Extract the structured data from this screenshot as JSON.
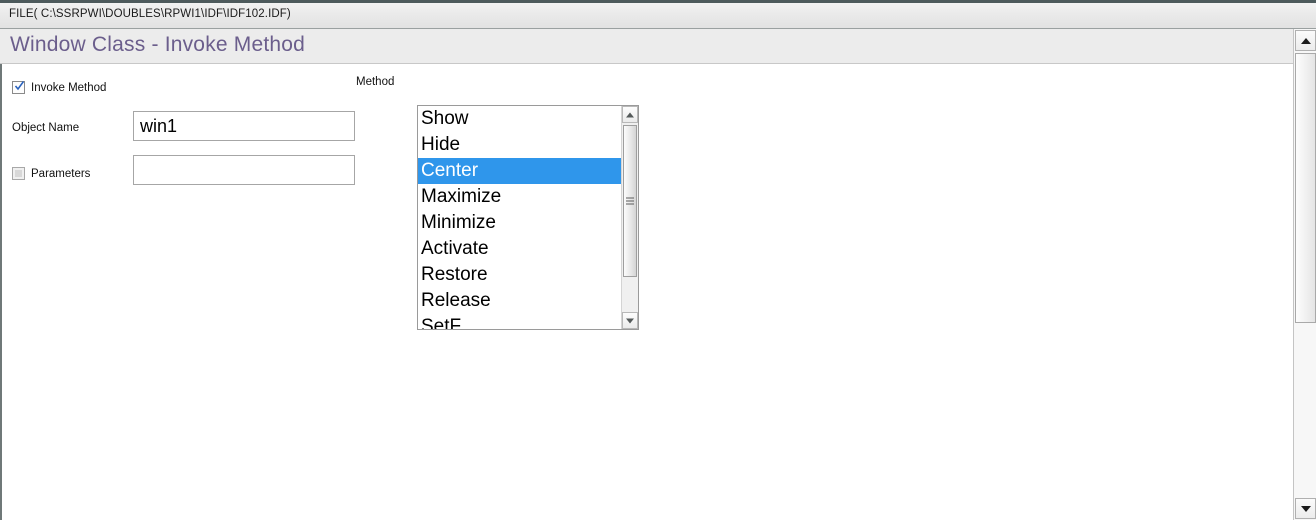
{
  "filebar": {
    "text": "FILE( C:\\SSRPWI\\DOUBLES\\RPWI1\\IDF\\IDF102.IDF)"
  },
  "window": {
    "title": "Window Class - Invoke Method"
  },
  "form": {
    "invoke_method": {
      "label": "Invoke Method",
      "checked": "true"
    },
    "object_name": {
      "label": "Object Name",
      "value": "win1",
      "placeholder": ""
    },
    "parameters": {
      "label": "Parameters",
      "checked": "false",
      "value": "",
      "placeholder": ""
    },
    "method": {
      "label": "Method",
      "selected": "Center",
      "items": [
        "Show",
        "Hide",
        "Center",
        "Maximize",
        "Minimize",
        "Activate",
        "Restore",
        "Release",
        "SetF"
      ]
    }
  },
  "colors": {
    "title_purple": "#6b5e8c",
    "selection_blue": "#2f96eb",
    "header_bg": "#ececec",
    "filebar_bg": "#eaeaea"
  },
  "icons": {
    "checkmark": "check-icon",
    "scroll_up": "triangle-up-icon",
    "scroll_down": "triangle-down-icon"
  }
}
